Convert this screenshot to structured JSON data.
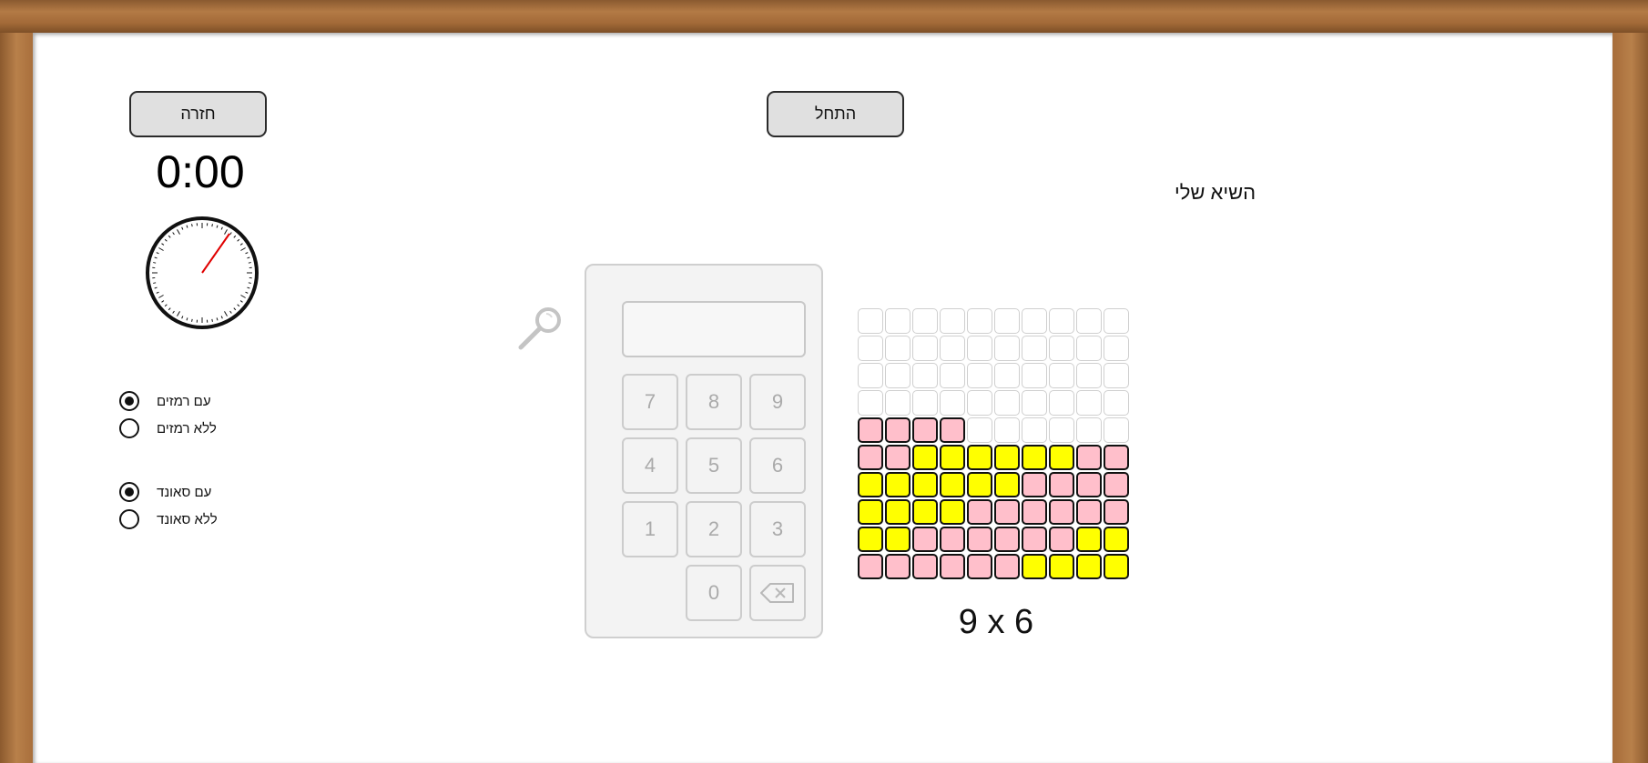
{
  "buttons": {
    "back_label": "חזרה",
    "start_label": "התחל"
  },
  "timer": {
    "display": "0:00"
  },
  "options": {
    "hints": [
      {
        "label": "עם רמזים",
        "selected": true
      },
      {
        "label": "ללא רמזים",
        "selected": false
      }
    ],
    "sound": [
      {
        "label": "עם סאונד",
        "selected": true
      },
      {
        "label": "ללא סאונד",
        "selected": false
      }
    ]
  },
  "record": {
    "label": "השיא שלי"
  },
  "calculator": {
    "display_value": "",
    "keys": [
      "7",
      "8",
      "9",
      "4",
      "5",
      "6",
      "1",
      "2",
      "3",
      "0"
    ],
    "backspace_icon": "backspace-icon"
  },
  "grid": {
    "rows": [
      "EEEEEEEEEE",
      "EEEEEEEEEE",
      "EEEEEEEEEE",
      "EEEEEEEEEE",
      "PPPPEEEEEE",
      "PPYYYYYYPP",
      "YYYYYYPPPP",
      "YYYYPPPPPP",
      "YYPPPPPPYY",
      "PPPPPPYYYY"
    ],
    "colors": {
      "E": "#ffffff",
      "P": "#ffbfcb",
      "Y": "#ffff00"
    }
  },
  "problem": {
    "text": "9 x 6"
  },
  "icons": {
    "magnifier": "magnifier-icon",
    "clock": "stopwatch-icon"
  }
}
